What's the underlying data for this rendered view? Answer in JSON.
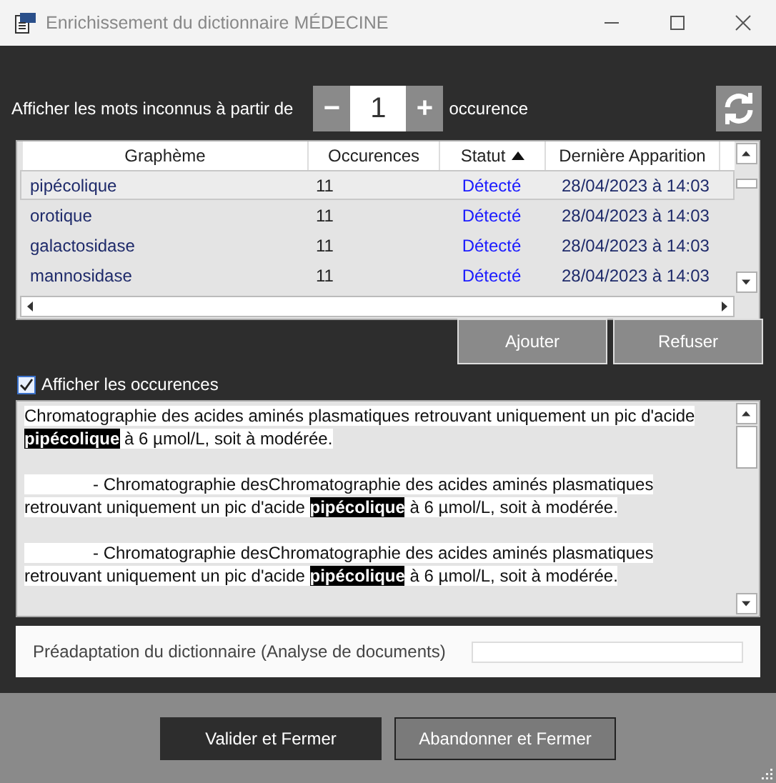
{
  "window": {
    "title": "Enrichissement du dictionnaire MÉDECINE"
  },
  "threshold": {
    "label": "Afficher les mots inconnus à partir de",
    "minus": "−",
    "value": "1",
    "plus": "+",
    "suffix": "occurence"
  },
  "table": {
    "columns": [
      {
        "label": "Graphème",
        "sorted": false
      },
      {
        "label": "Occurences",
        "sorted": false
      },
      {
        "label": "Statut",
        "sorted": true
      },
      {
        "label": "Dernière Apparition",
        "sorted": false
      }
    ],
    "rows": [
      {
        "cells": [
          "pipécolique",
          "11",
          "Détecté",
          "28/04/2023 à 14:03"
        ],
        "selected": true
      },
      {
        "cells": [
          "orotique",
          "11",
          "Détecté",
          "28/04/2023 à 14:03"
        ],
        "selected": false
      },
      {
        "cells": [
          "galactosidase",
          "11",
          "Détecté",
          "28/04/2023 à 14:03"
        ],
        "selected": false
      },
      {
        "cells": [
          "mannosidase",
          "11",
          "Détecté",
          "28/04/2023 à 14:03"
        ],
        "selected": false
      }
    ]
  },
  "actions": [
    "Ajouter",
    "Refuser"
  ],
  "show_occurrences": {
    "label": "Afficher les occurences",
    "checked": true
  },
  "occurrences": [
    {
      "indented": false,
      "before": "Chromatographie des acides aminés plasmatiques retrouvant uniquement un pic d'acide ",
      "match": "pipécolique",
      "after": " à 6 µmol/L, soit à modérée."
    },
    {
      "indented": true,
      "before": "- Chromatographie desChromatographie des acides aminés plasmatiques retrouvant uniquement un pic d'acide ",
      "match": "pipécolique",
      "after": " à 6 µmol/L, soit à modérée."
    },
    {
      "indented": true,
      "before": "- Chromatographie desChromatographie des acides aminés plasmatiques retrouvant uniquement un pic d'acide ",
      "match": "pipécolique",
      "after": " à 6 µmol/L, soit à modérée."
    }
  ],
  "preadaptation": {
    "label": "Préadaptation du dictionnaire (Analyse de documents)",
    "level": 0
  },
  "buttons": [
    {
      "label": "Valider et Fermer",
      "kind": "primary"
    },
    {
      "label": "Abandonner et Fermer",
      "kind": "secondary"
    }
  ]
}
